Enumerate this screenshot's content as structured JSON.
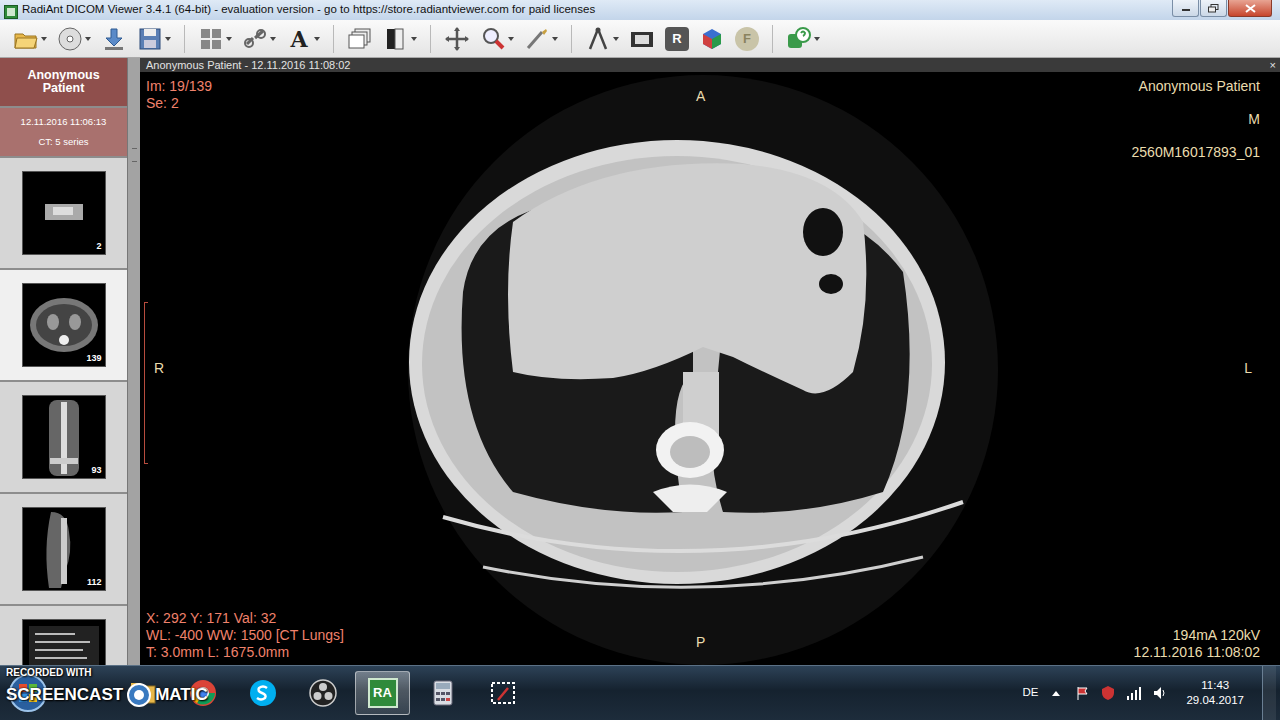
{
  "window": {
    "title": "RadiAnt DICOM Viewer 3.4.1 (64-bit) - evaluation version - go to https://store.radiantviewer.com for paid licenses"
  },
  "toolbar": {
    "text_glyph": "A",
    "reset_glyph": "R",
    "fusion_glyph": "F"
  },
  "sidebar": {
    "patient": "Anonymous Patient",
    "study": {
      "date": "12.11.2016 11:06:13",
      "series_count": "CT: 5 series"
    },
    "series": [
      {
        "kind": "scout",
        "count": "2",
        "selected": false
      },
      {
        "kind": "axial",
        "count": "139",
        "selected": true
      },
      {
        "kind": "coronal",
        "count": "93",
        "selected": false
      },
      {
        "kind": "sagittal",
        "count": "112",
        "selected": false
      },
      {
        "kind": "report",
        "selected": false
      }
    ]
  },
  "viewer": {
    "header": "Anonymous Patient - 12.11.2016 11:08:02",
    "close": "×",
    "top_left": [
      "Im: 19/139",
      "Se: 2"
    ],
    "top_right": [
      "Anonymous Patient",
      "M",
      "2560M16017893_01"
    ],
    "orientation": {
      "top": "A",
      "left": "R",
      "right": "L",
      "bottom": "P"
    },
    "bottom_left": [
      "X: 292 Y: 171 Val: 32",
      "WL: -400 WW: 1500 [CT Lungs]",
      "T: 3.0mm L: 1675.0mm"
    ],
    "bottom_right": [
      "194mA 120kV",
      "12.11.2016 11:08:02"
    ]
  },
  "taskbar": {
    "watermark": [
      "RECORDED WITH",
      "SCREENCAST",
      "MATIC"
    ],
    "apps": [
      {
        "kind": "explorer",
        "active": false
      },
      {
        "kind": "chrome",
        "active": false
      },
      {
        "kind": "skype",
        "active": false
      },
      {
        "kind": "obs",
        "active": false
      },
      {
        "kind": "radiant",
        "label": "RA",
        "active": true
      },
      {
        "kind": "calculator",
        "active": false
      },
      {
        "kind": "snipping",
        "active": false
      }
    ],
    "language": "DE",
    "time": "11:43",
    "date": "29.04.2017"
  }
}
